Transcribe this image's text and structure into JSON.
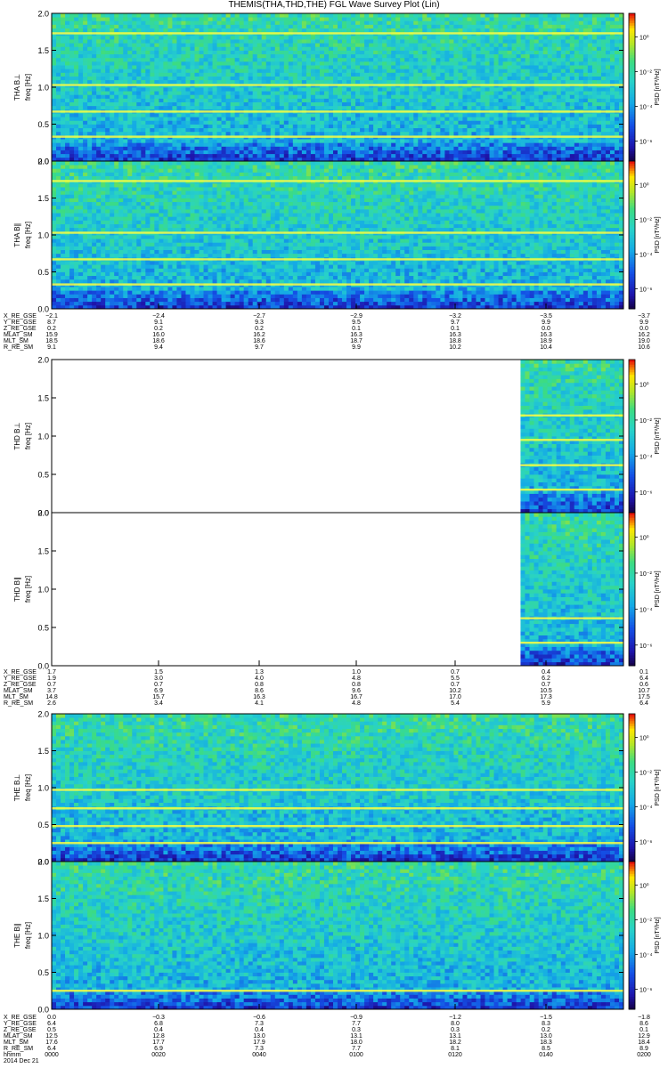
{
  "title": "THEMIS(THA,THD,THE) FGL Wave Survey Plot (Lin)",
  "colors": {
    "frame": "#000000",
    "line_band": "#ffff40",
    "background": "#ffffff"
  },
  "chart_data": [
    {
      "type": "heatmap",
      "probe": "THA",
      "ylabel": [
        "THA B⊥",
        "freq [Hz]"
      ],
      "zlabel": "PSD [nT²/Hz]",
      "ylim": [
        0.0,
        2.0
      ],
      "yticks": [
        "0.0",
        "0.5",
        "1.0",
        "1.5",
        "2.0"
      ],
      "zticks": [
        "10⁰",
        "10⁻²",
        "10⁻⁴",
        "10⁻⁶"
      ],
      "zlog": true,
      "bands_hz": [
        0.33,
        0.67,
        1.03,
        1.73
      ],
      "data_fraction": [
        0.0,
        1.0
      ]
    },
    {
      "type": "heatmap",
      "probe": "THA",
      "ylabel": [
        "THA B∥",
        "freq [Hz]"
      ],
      "zlabel": "PSD [nT²/Hz]",
      "ylim": [
        0.0,
        2.0
      ],
      "yticks": [
        "0.0",
        "0.5",
        "1.0",
        "1.5",
        "2.0"
      ],
      "zticks": [
        "10⁰",
        "10⁻²",
        "10⁻⁴",
        "10⁻⁶"
      ],
      "zlog": true,
      "bands_hz": [
        0.33,
        0.67,
        1.03,
        1.73
      ],
      "data_fraction": [
        0.0,
        1.0
      ]
    },
    {
      "type": "heatmap",
      "probe": "THD",
      "ylabel": [
        "THD B⊥",
        "freq [Hz]"
      ],
      "zlabel": "PSD [nT²/Hz]",
      "ylim": [
        0.0,
        2.0
      ],
      "yticks": [
        "0.0",
        "0.5",
        "1.0",
        "1.5",
        "2.0"
      ],
      "zticks": [
        "10⁰",
        "10⁻²",
        "10⁻⁴",
        "10⁻⁶"
      ],
      "zlog": true,
      "bands_hz": [
        0.3,
        0.62,
        0.95,
        1.27
      ],
      "data_fraction": [
        0.82,
        1.0
      ]
    },
    {
      "type": "heatmap",
      "probe": "THD",
      "ylabel": [
        "THD B∥",
        "freq [Hz]"
      ],
      "zlabel": "PSD [nT²/Hz]",
      "ylim": [
        0.0,
        2.0
      ],
      "yticks": [
        "0.0",
        "0.5",
        "1.0",
        "1.5",
        "2.0"
      ],
      "zticks": [
        "10⁰",
        "10⁻²",
        "10⁻⁴",
        "10⁻⁶"
      ],
      "zlog": true,
      "bands_hz": [
        0.3,
        0.62
      ],
      "data_fraction": [
        0.82,
        1.0
      ]
    },
    {
      "type": "heatmap",
      "probe": "THE",
      "ylabel": [
        "THE B⊥",
        "freq [Hz]"
      ],
      "zlabel": "PSD [nT²/Hz]",
      "ylim": [
        0.0,
        2.0
      ],
      "yticks": [
        "0.0",
        "0.5",
        "1.0",
        "1.5",
        "2.0"
      ],
      "zticks": [
        "10⁰",
        "10⁻²",
        "10⁻⁴",
        "10⁻⁶"
      ],
      "zlog": true,
      "bands_hz": [
        0.25,
        0.48,
        0.72,
        0.97
      ],
      "data_fraction": [
        0.0,
        1.0
      ]
    },
    {
      "type": "heatmap",
      "probe": "THE",
      "ylabel": [
        "THE B∥",
        "freq [Hz]"
      ],
      "zlabel": "PSD [nT²/Hz]",
      "ylim": [
        0.0,
        2.0
      ],
      "yticks": [
        "0.0",
        "0.5",
        "1.0",
        "1.5",
        "2.0"
      ],
      "zticks": [
        "10⁰",
        "10⁻²",
        "10⁻⁴",
        "10⁻⁶"
      ],
      "zlog": true,
      "bands_hz": [
        0.25
      ],
      "data_fraction": [
        0.0,
        1.0
      ]
    }
  ],
  "ephemeris": [
    {
      "probe": "THA",
      "rows": [
        {
          "label": "X_RE_GSE",
          "values": [
            "−2.1",
            "−2.4",
            "−2.7",
            "−2.9",
            "−3.2",
            "−3.5",
            "−3.7"
          ]
        },
        {
          "label": "Y_RE_GSE",
          "values": [
            "8.7",
            "9.1",
            "9.3",
            "9.5",
            "9.7",
            "9.9",
            "9.9"
          ]
        },
        {
          "label": "Z_RE_GSE",
          "values": [
            "0.2",
            "0.2",
            "0.2",
            "0.1",
            "0.1",
            "0.0",
            "0.0"
          ]
        },
        {
          "label": "MLAT_SM",
          "values": [
            "15.9",
            "16.0",
            "16.2",
            "16.3",
            "16.3",
            "16.3",
            "16.2"
          ]
        },
        {
          "label": "MLT_SM",
          "values": [
            "18.5",
            "18.6",
            "18.6",
            "18.7",
            "18.8",
            "18.9",
            "19.0"
          ]
        },
        {
          "label": "R_RE_SM",
          "values": [
            "9.1",
            "9.4",
            "9.7",
            "9.9",
            "10.2",
            "10.4",
            "10.6"
          ]
        }
      ]
    },
    {
      "probe": "THD",
      "rows": [
        {
          "label": "X_RE_GSE",
          "values": [
            "1.7",
            "1.5",
            "1.3",
            "1.0",
            "0.7",
            "0.4",
            "0.1"
          ]
        },
        {
          "label": "Y_RE_GSE",
          "values": [
            "1.9",
            "3.0",
            "4.0",
            "4.8",
            "5.5",
            "6.2",
            "6.4"
          ]
        },
        {
          "label": "Z_RE_GSE",
          "values": [
            "0.7",
            "0.7",
            "0.8",
            "0.8",
            "0.7",
            "0.7",
            "0.6"
          ]
        },
        {
          "label": "MLAT_SM",
          "values": [
            "3.7",
            "6.9",
            "8.6",
            "9.6",
            "10.2",
            "10.5",
            "10.7"
          ]
        },
        {
          "label": "MLT_SM",
          "values": [
            "14.8",
            "15.7",
            "16.3",
            "16.7",
            "17.0",
            "17.3",
            "17.5"
          ]
        },
        {
          "label": "R_RE_SM",
          "values": [
            "2.6",
            "3.4",
            "4.1",
            "4.8",
            "5.4",
            "5.9",
            "6.4"
          ]
        }
      ]
    },
    {
      "probe": "THE",
      "rows": [
        {
          "label": "X_RE_GSE",
          "values": [
            "0.0",
            "−0.3",
            "−0.6",
            "−0.9",
            "−1.2",
            "−1.5",
            "−1.8"
          ]
        },
        {
          "label": "Y_RE_GSE",
          "values": [
            "6.4",
            "6.8",
            "7.3",
            "7.7",
            "8.0",
            "8.3",
            "8.6"
          ]
        },
        {
          "label": "Z_RE_GSE",
          "values": [
            "0.5",
            "0.4",
            "0.4",
            "0.3",
            "0.3",
            "0.2",
            "0.1"
          ]
        },
        {
          "label": "MLAT_SM",
          "values": [
            "12.5",
            "12.8",
            "13.0",
            "13.1",
            "13.1",
            "13.0",
            "12.9"
          ]
        },
        {
          "label": "MLT_SM",
          "values": [
            "17.6",
            "17.7",
            "17.9",
            "18.0",
            "18.2",
            "18.3",
            "18.4"
          ]
        },
        {
          "label": "R_RE_SM",
          "values": [
            "6.4",
            "6.9",
            "7.3",
            "7.7",
            "8.1",
            "8.5",
            "8.9"
          ]
        },
        {
          "label": "hhmm",
          "values": [
            "0000",
            "0020",
            "0040",
            "0100",
            "0120",
            "0140",
            "0200"
          ]
        },
        {
          "label": "2014 Dec 21",
          "values": []
        }
      ]
    }
  ]
}
